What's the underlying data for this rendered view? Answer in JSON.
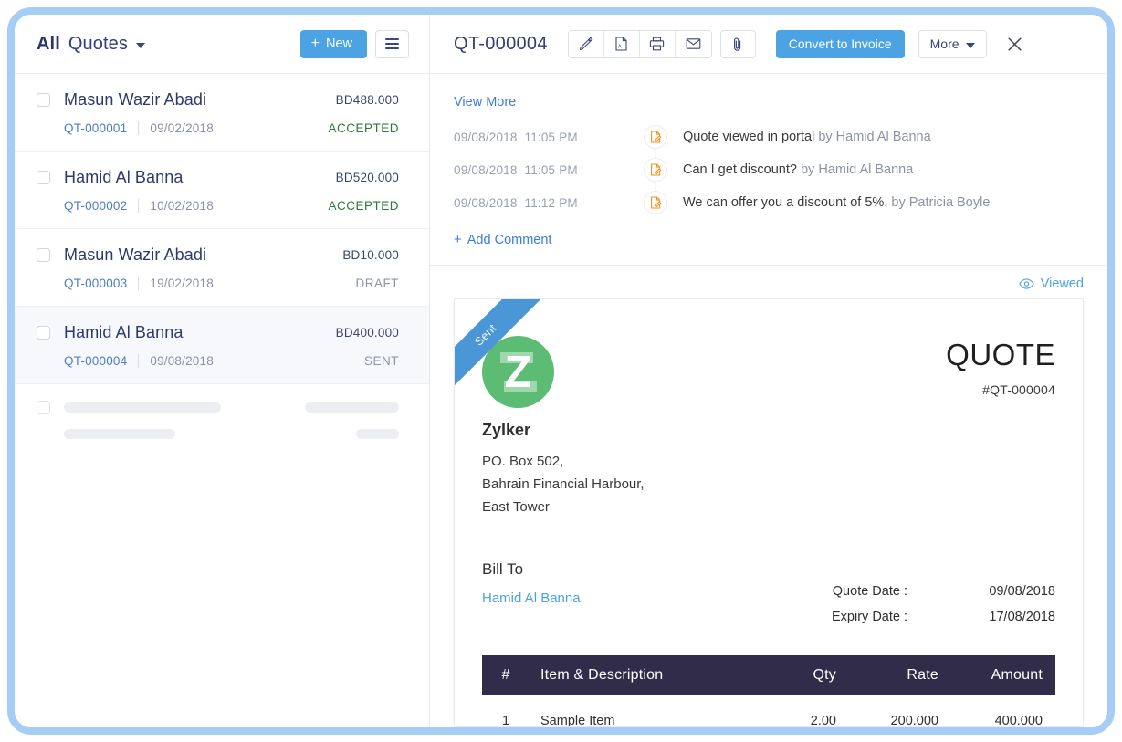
{
  "list_pane": {
    "title_prefix": "All",
    "title_suffix": "Quotes",
    "new_button": "New",
    "rows": [
      {
        "name": "Masun Wazir Abadi",
        "amount": "BD488.000",
        "number": "QT-000001",
        "date": "09/02/2018",
        "status": "ACCEPTED",
        "status_kind": "accepted",
        "selected": false
      },
      {
        "name": "Hamid Al Banna",
        "amount": "BD520.000",
        "number": "QT-000002",
        "date": "10/02/2018",
        "status": "ACCEPTED",
        "status_kind": "accepted",
        "selected": false
      },
      {
        "name": "Masun Wazir Abadi",
        "amount": "BD10.000",
        "number": "QT-000003",
        "date": "19/02/2018",
        "status": "DRAFT",
        "status_kind": "draft",
        "selected": false
      },
      {
        "name": "Hamid Al Banna",
        "amount": "BD400.000",
        "number": "QT-000004",
        "date": "09/08/2018",
        "status": "SENT",
        "status_kind": "sent",
        "selected": true
      }
    ]
  },
  "detail_pane": {
    "title": "QT-000004",
    "toolbar": {
      "edit_icon": "pencil-icon",
      "pdf_icon": "pdf-file-icon",
      "print_icon": "printer-icon",
      "email_icon": "envelope-icon",
      "attach_icon": "paperclip-icon",
      "convert_label": "Convert to Invoice",
      "more_label": "More",
      "close_icon": "close-icon"
    },
    "timeline": {
      "view_more": "View More",
      "add_comment": "Add Comment",
      "entries": [
        {
          "date": "09/08/2018",
          "time": "11:05 PM",
          "text": "Quote viewed in portal",
          "by": "by Hamid Al Banna"
        },
        {
          "date": "09/08/2018",
          "time": "11:05 PM",
          "text": "Can I get discount?",
          "by": "by Hamid Al Banna"
        },
        {
          "date": "09/08/2018",
          "time": "11:12 PM",
          "text": "We can offer you a discount of 5%.",
          "by": "by Patricia Boyle"
        }
      ]
    },
    "viewed_badge": "Viewed",
    "document": {
      "ribbon": "Sent",
      "logo_letter": "Z",
      "company_name": "Zylker",
      "address": [
        "PO. Box 502,",
        "Bahrain Financial Harbour,",
        "East Tower"
      ],
      "doc_word": "QUOTE",
      "doc_ref": "#QT-000004",
      "billto_label": "Bill To",
      "billto_name": "Hamid Al Banna",
      "dates": [
        {
          "label": "Quote Date :",
          "value": "09/08/2018"
        },
        {
          "label": "Expiry Date :",
          "value": "17/08/2018"
        }
      ],
      "table": {
        "headers": {
          "idx": "#",
          "desc": "Item & Description",
          "qty": "Qty",
          "rate": "Rate",
          "amount": "Amount"
        },
        "rows": [
          {
            "idx": "1",
            "desc": "Sample Item",
            "qty": "2.00",
            "rate": "200.000",
            "amount": "400.000"
          }
        ]
      }
    }
  },
  "colors": {
    "accent_blue": "#4BA3E3",
    "frame_blue": "#A6CDF5",
    "logo_green": "#5CBC74",
    "table_header": "#322C4B",
    "accepted_green": "#2B7A39",
    "timeline_icon_orange": "#F0921E"
  }
}
